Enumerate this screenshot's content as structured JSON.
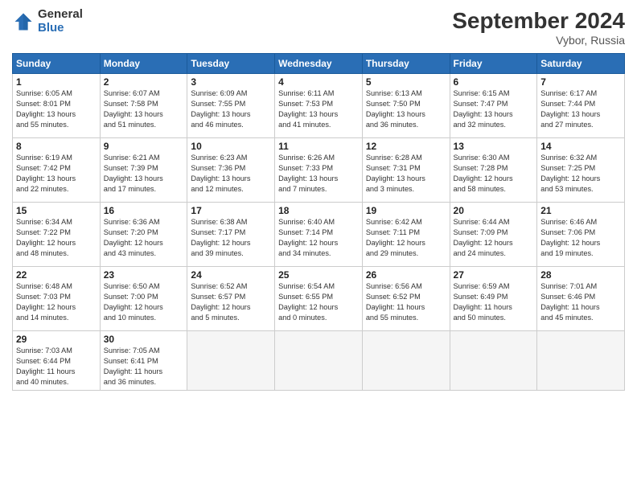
{
  "logo": {
    "general": "General",
    "blue": "Blue"
  },
  "header": {
    "month": "September 2024",
    "location": "Vybor, Russia"
  },
  "weekdays": [
    "Sunday",
    "Monday",
    "Tuesday",
    "Wednesday",
    "Thursday",
    "Friday",
    "Saturday"
  ],
  "weeks": [
    [
      {
        "day": "1",
        "info": "Sunrise: 6:05 AM\nSunset: 8:01 PM\nDaylight: 13 hours\nand 55 minutes."
      },
      {
        "day": "2",
        "info": "Sunrise: 6:07 AM\nSunset: 7:58 PM\nDaylight: 13 hours\nand 51 minutes."
      },
      {
        "day": "3",
        "info": "Sunrise: 6:09 AM\nSunset: 7:55 PM\nDaylight: 13 hours\nand 46 minutes."
      },
      {
        "day": "4",
        "info": "Sunrise: 6:11 AM\nSunset: 7:53 PM\nDaylight: 13 hours\nand 41 minutes."
      },
      {
        "day": "5",
        "info": "Sunrise: 6:13 AM\nSunset: 7:50 PM\nDaylight: 13 hours\nand 36 minutes."
      },
      {
        "day": "6",
        "info": "Sunrise: 6:15 AM\nSunset: 7:47 PM\nDaylight: 13 hours\nand 32 minutes."
      },
      {
        "day": "7",
        "info": "Sunrise: 6:17 AM\nSunset: 7:44 PM\nDaylight: 13 hours\nand 27 minutes."
      }
    ],
    [
      {
        "day": "8",
        "info": "Sunrise: 6:19 AM\nSunset: 7:42 PM\nDaylight: 13 hours\nand 22 minutes."
      },
      {
        "day": "9",
        "info": "Sunrise: 6:21 AM\nSunset: 7:39 PM\nDaylight: 13 hours\nand 17 minutes."
      },
      {
        "day": "10",
        "info": "Sunrise: 6:23 AM\nSunset: 7:36 PM\nDaylight: 13 hours\nand 12 minutes."
      },
      {
        "day": "11",
        "info": "Sunrise: 6:26 AM\nSunset: 7:33 PM\nDaylight: 13 hours\nand 7 minutes."
      },
      {
        "day": "12",
        "info": "Sunrise: 6:28 AM\nSunset: 7:31 PM\nDaylight: 13 hours\nand 3 minutes."
      },
      {
        "day": "13",
        "info": "Sunrise: 6:30 AM\nSunset: 7:28 PM\nDaylight: 12 hours\nand 58 minutes."
      },
      {
        "day": "14",
        "info": "Sunrise: 6:32 AM\nSunset: 7:25 PM\nDaylight: 12 hours\nand 53 minutes."
      }
    ],
    [
      {
        "day": "15",
        "info": "Sunrise: 6:34 AM\nSunset: 7:22 PM\nDaylight: 12 hours\nand 48 minutes."
      },
      {
        "day": "16",
        "info": "Sunrise: 6:36 AM\nSunset: 7:20 PM\nDaylight: 12 hours\nand 43 minutes."
      },
      {
        "day": "17",
        "info": "Sunrise: 6:38 AM\nSunset: 7:17 PM\nDaylight: 12 hours\nand 39 minutes."
      },
      {
        "day": "18",
        "info": "Sunrise: 6:40 AM\nSunset: 7:14 PM\nDaylight: 12 hours\nand 34 minutes."
      },
      {
        "day": "19",
        "info": "Sunrise: 6:42 AM\nSunset: 7:11 PM\nDaylight: 12 hours\nand 29 minutes."
      },
      {
        "day": "20",
        "info": "Sunrise: 6:44 AM\nSunset: 7:09 PM\nDaylight: 12 hours\nand 24 minutes."
      },
      {
        "day": "21",
        "info": "Sunrise: 6:46 AM\nSunset: 7:06 PM\nDaylight: 12 hours\nand 19 minutes."
      }
    ],
    [
      {
        "day": "22",
        "info": "Sunrise: 6:48 AM\nSunset: 7:03 PM\nDaylight: 12 hours\nand 14 minutes."
      },
      {
        "day": "23",
        "info": "Sunrise: 6:50 AM\nSunset: 7:00 PM\nDaylight: 12 hours\nand 10 minutes."
      },
      {
        "day": "24",
        "info": "Sunrise: 6:52 AM\nSunset: 6:57 PM\nDaylight: 12 hours\nand 5 minutes."
      },
      {
        "day": "25",
        "info": "Sunrise: 6:54 AM\nSunset: 6:55 PM\nDaylight: 12 hours\nand 0 minutes."
      },
      {
        "day": "26",
        "info": "Sunrise: 6:56 AM\nSunset: 6:52 PM\nDaylight: 11 hours\nand 55 minutes."
      },
      {
        "day": "27",
        "info": "Sunrise: 6:59 AM\nSunset: 6:49 PM\nDaylight: 11 hours\nand 50 minutes."
      },
      {
        "day": "28",
        "info": "Sunrise: 7:01 AM\nSunset: 6:46 PM\nDaylight: 11 hours\nand 45 minutes."
      }
    ],
    [
      {
        "day": "29",
        "info": "Sunrise: 7:03 AM\nSunset: 6:44 PM\nDaylight: 11 hours\nand 40 minutes."
      },
      {
        "day": "30",
        "info": "Sunrise: 7:05 AM\nSunset: 6:41 PM\nDaylight: 11 hours\nand 36 minutes."
      },
      {
        "day": "",
        "info": ""
      },
      {
        "day": "",
        "info": ""
      },
      {
        "day": "",
        "info": ""
      },
      {
        "day": "",
        "info": ""
      },
      {
        "day": "",
        "info": ""
      }
    ]
  ]
}
